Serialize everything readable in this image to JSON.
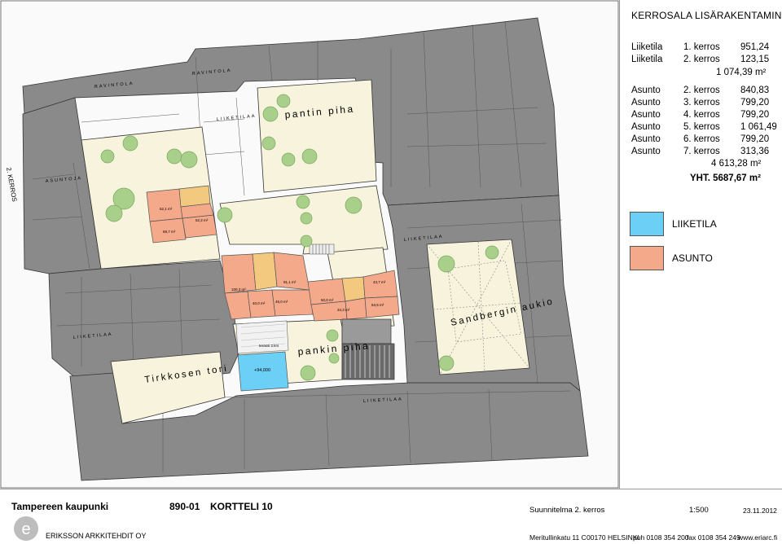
{
  "legend": {
    "title": "KERROSALA LISÄRAKENTAMINEN",
    "commercial_rows": [
      {
        "type": "Liiketila",
        "floor": "1. kerros",
        "area": "951,24"
      },
      {
        "type": "Liiketila",
        "floor": "2. kerros",
        "area": "123,15"
      }
    ],
    "commercial_subtotal": "1 074,39 m²",
    "residential_rows": [
      {
        "type": "Asunto",
        "floor": "2. kerros",
        "area": "840,83"
      },
      {
        "type": "Asunto",
        "floor": "3. kerros",
        "area": "799,20"
      },
      {
        "type": "Asunto",
        "floor": "4. kerros",
        "area": "799,20"
      },
      {
        "type": "Asunto",
        "floor": "5. kerros",
        "area": "1 061,49"
      },
      {
        "type": "Asunto",
        "floor": "6. kerros",
        "area": "799,20"
      },
      {
        "type": "Asunto",
        "floor": "7. kerros",
        "area": "313,36"
      }
    ],
    "residential_subtotal": "4 613,28 m²",
    "total": "YHT. 5687,67 m²",
    "key": {
      "liiketila": {
        "label": "LIIKETILA",
        "color": "#6ccff6"
      },
      "asunto": {
        "label": "ASUNTO",
        "color": "#f4a98a"
      }
    }
  },
  "plan": {
    "floor_label": "2. KERROS",
    "places": {
      "pantin_piha": "pantin piha",
      "pankin_piha": "pankin piha",
      "sandbergin_aukio": "Sandbergin aukio",
      "tirkkosen_tori": "Tirkkosen tori"
    },
    "building_labels": [
      "RAVINTOLA",
      "RAVINTOLA",
      "LIIKETILAA",
      "ASUNTOJA",
      "LIIKETILAA",
      "LIIKETILAA",
      "LIIKETILAA"
    ],
    "apartment_areas": [
      "52,1 m²",
      "69,7 m²",
      "52,2 m²",
      "100,3 m²",
      "91,1 m²",
      "40,0 m²",
      "45,0 m²",
      "43,7 m²",
      "50,0 m²",
      "34,3 m²",
      "53,5 m²"
    ],
    "terrace_label": "terassi 2.krs",
    "elevation_label": "+94,000",
    "colors": {
      "courtyard": "#f7f3dc",
      "building": "#8a8a8a",
      "tree": "#a8d08a",
      "liiketila": "#6ccff6",
      "asunto": "#f4a98a",
      "stair": "#f2c97e"
    }
  },
  "footer": {
    "client": "Tampereen kaupunki",
    "project_no": "890-01",
    "block": "KORTTELI 10",
    "drawing": "Suunnitelma 2. kerros",
    "scale": "1:500",
    "date": "23.11.2012",
    "office": "ERIKSSON ARKKITEHDIT OY",
    "street": "Meritullinkatu 11 C",
    "postcode_city": "00170 HELSINKI",
    "phone": "puh 0108 354 200",
    "fax": "fax 0108 354 249",
    "web": "www.eriarc.fi"
  }
}
